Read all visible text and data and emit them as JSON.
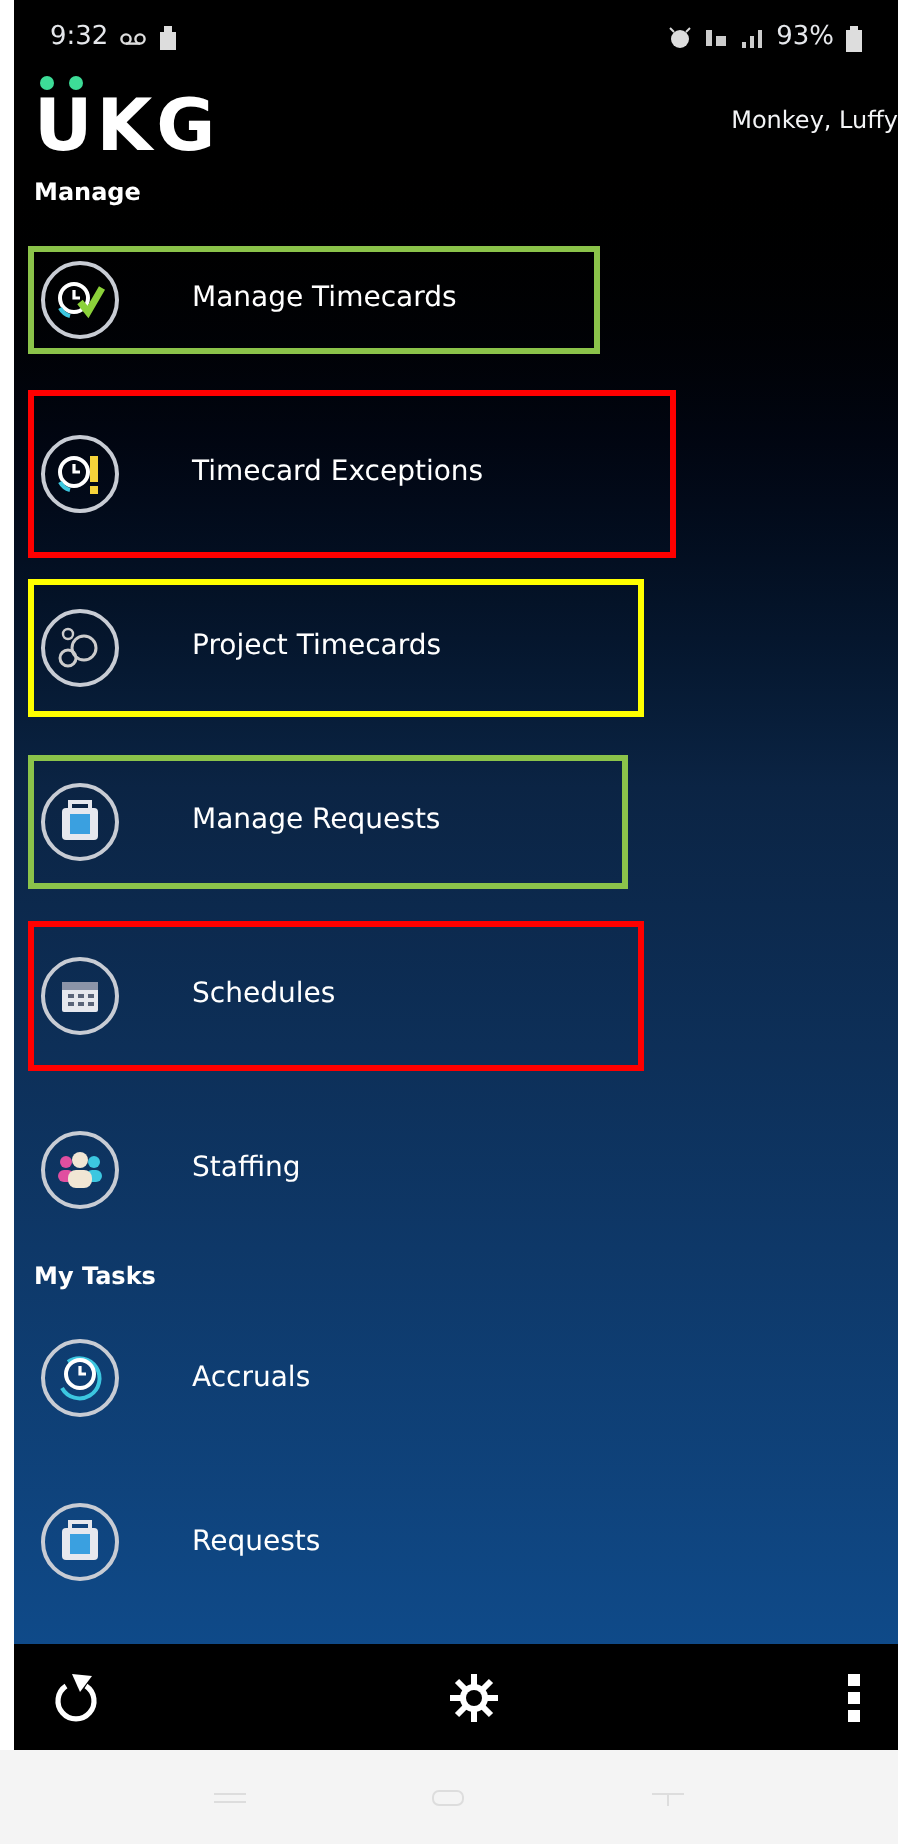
{
  "status_bar": {
    "time": "9:32",
    "battery": "93%"
  },
  "header": {
    "logo": "UKG",
    "user": "Monkey, Luffy"
  },
  "sections": [
    {
      "title": "Manage",
      "items": [
        {
          "label": "Manage Timecards",
          "color": "#8bc34a"
        },
        {
          "label": "Timecard Exceptions",
          "color": "#ff0000"
        },
        {
          "label": "Project Timecards",
          "color": "#ffff00"
        },
        {
          "label": "Manage Requests",
          "color": "#8bc34a"
        },
        {
          "label": "Schedules",
          "color": "#ff0000"
        },
        {
          "label": "Staffing"
        }
      ]
    },
    {
      "title": "My Tasks",
      "items": [
        {
          "label": "Accruals"
        },
        {
          "label": "Requests"
        }
      ]
    }
  ]
}
